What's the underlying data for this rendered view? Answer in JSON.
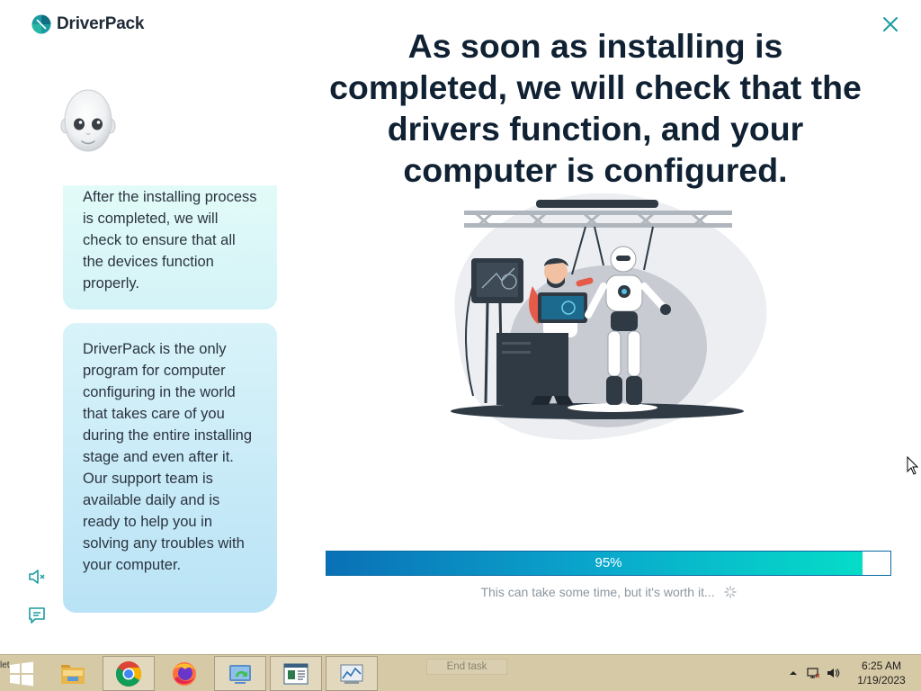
{
  "app": {
    "logo_text": "DriverPack",
    "headline": "As soon as installing is completed, we will check that the drivers function, and your computer is configured.",
    "chat": [
      "After the installing process is completed, we will check to ensure that all the devices function properly.",
      "DriverPack is the only program for computer configuring in the world that takes care of you during the entire installing stage and even after it. Our support team is available daily and is ready to help you in solving any troubles with your computer."
    ],
    "progress": {
      "percent": 95,
      "label": "95%"
    },
    "hint": "This can take some time, but it's worth it...",
    "icons": {
      "close": "close-icon",
      "mute": "speaker-mute-icon",
      "chat": "chat-icon"
    },
    "colors": {
      "brand": "#1a9ba1",
      "progress_start": "#0a70b6",
      "progress_end": "#05dcc8",
      "headline": "#0f2132"
    }
  },
  "taskbar": {
    "left_fragment": "let",
    "end_task": "End task",
    "apps": [
      "file-explorer",
      "chrome",
      "firefox",
      "driverpack-installer",
      "notepad-document",
      "performance-monitor"
    ],
    "clock": {
      "time": "6:25 AM",
      "date": "1/19/2023"
    }
  }
}
